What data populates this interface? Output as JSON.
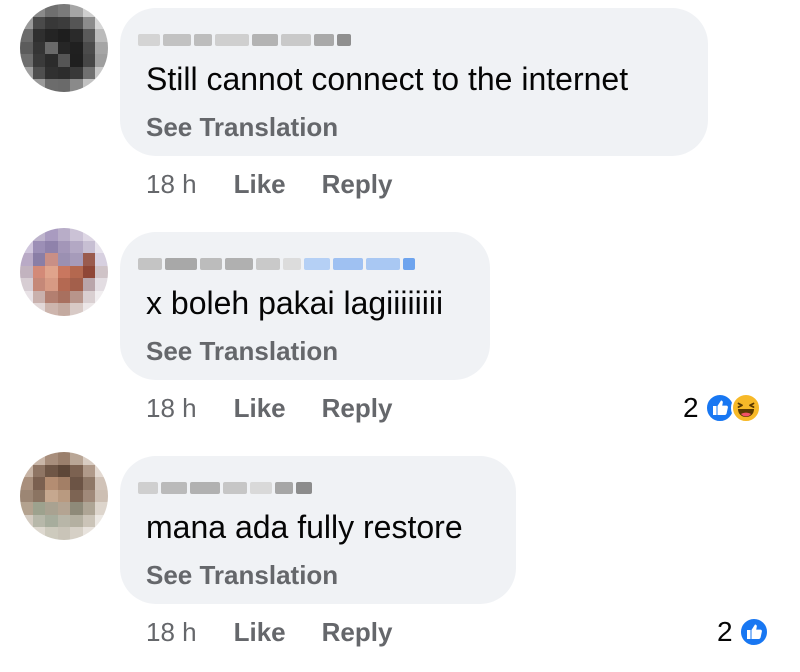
{
  "comments": [
    {
      "text": "Still cannot connect to the internet",
      "translate": "See Translation",
      "time": "18 h",
      "like": "Like",
      "reply": "Reply",
      "reactions": null
    },
    {
      "text": "x boleh pakai lagiiiiiiii",
      "translate": "See Translation",
      "time": "18 h",
      "like": "Like",
      "reply": "Reply",
      "reactions": {
        "count": "2",
        "icons": [
          "like-icon",
          "haha-icon"
        ]
      }
    },
    {
      "text": "mana ada fully restore",
      "translate": "See Translation",
      "time": "18 h",
      "like": "Like",
      "reply": "Reply",
      "reactions": {
        "count": "2",
        "icons": [
          "like-icon"
        ]
      }
    }
  ],
  "colors": {
    "bubble": "#f0f2f5",
    "secondary_text": "#65676b",
    "like_blue": "#1877f2",
    "haha_yellow": "#f7b928"
  }
}
